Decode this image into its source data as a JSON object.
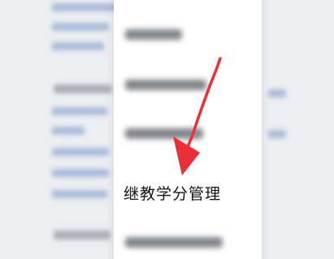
{
  "menu": {
    "highlighted_item_label": "继教学分管理"
  },
  "annotation": {
    "arrow_color": "#ec2f36"
  }
}
